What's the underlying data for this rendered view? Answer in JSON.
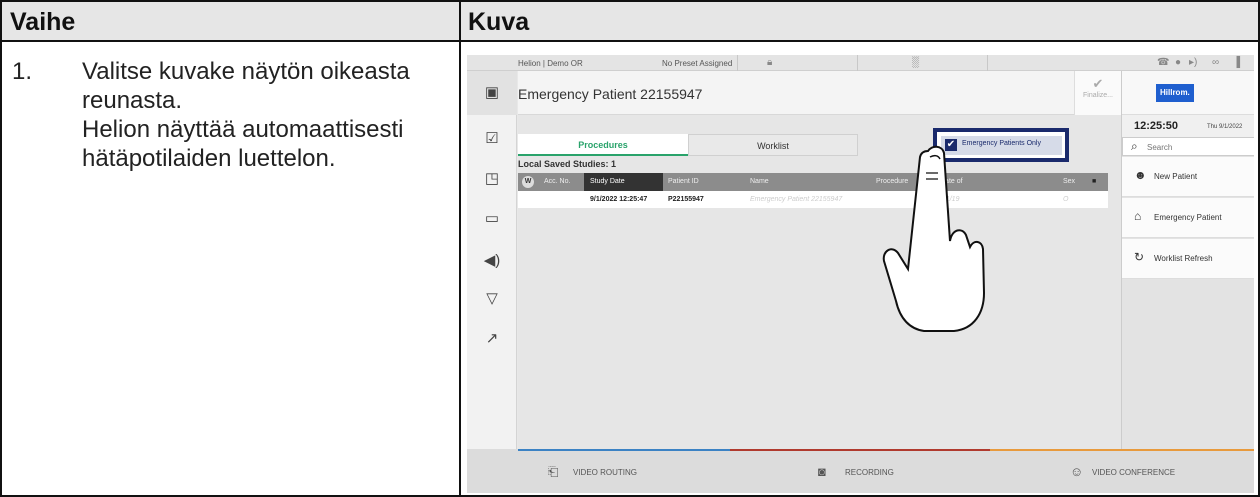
{
  "table": {
    "header_left": "Vaihe",
    "header_right": "Kuva",
    "step_number": "1.",
    "step_lines": [
      "Valitse kuvake näytön oikeasta",
      "reunasta.",
      "Helion näyttää automaattisesti",
      "hätäpotilaiden luettelon."
    ]
  },
  "screen": {
    "topbar": {
      "room": "Helion | Demo OR",
      "preset": "No Preset Assigned"
    },
    "patient_title": "Emergency Patient 22155947",
    "finalize_label": "Finalize...",
    "tabs": [
      "Procedures",
      "Worklist"
    ],
    "emergency_only_label": "Emergency Patients Only",
    "local_saved": "Local Saved Studies: 1",
    "columns": {
      "w": "W",
      "acc": "Acc. No.",
      "study_date": "Study Date",
      "patient_id": "Patient ID",
      "name": "Name",
      "procedure": "Procedure",
      "dob": "Date of",
      "sex": "Sex"
    },
    "row": {
      "study_date": "9/1/2022 12:25:47",
      "patient_id": "P22155947",
      "name": "Emergency Patient 22155947",
      "dob": "1/1/19",
      "sex": "O"
    },
    "brand": "Hillrom.",
    "time": "12:25:50",
    "date": "Thu 9/1/2022",
    "search_placeholder": "Search",
    "right_buttons": [
      "New Patient",
      "Emergency Patient",
      "Worklist Refresh"
    ],
    "bottom": [
      "VIDEO ROUTING",
      "RECORDING",
      "VIDEO CONFERENCE"
    ]
  },
  "colors": {
    "accent_green": "#2aa36b",
    "emergency_frame": "#1a2a6c",
    "brand_blue": "#1f5fcf",
    "routing_line": "#3b82c4",
    "recording_line": "#b03a2e",
    "conference_line": "#e89a3c"
  },
  "icons": [
    "patient-card-icon",
    "clipboard-icon",
    "layout-icon",
    "monitor-icon",
    "speaker-icon",
    "light-icon",
    "camera-icon",
    "lock-icon",
    "phone-icon",
    "search-icon",
    "add-user-icon",
    "emergency-icon",
    "refresh-icon",
    "hand-pointer-icon"
  ]
}
